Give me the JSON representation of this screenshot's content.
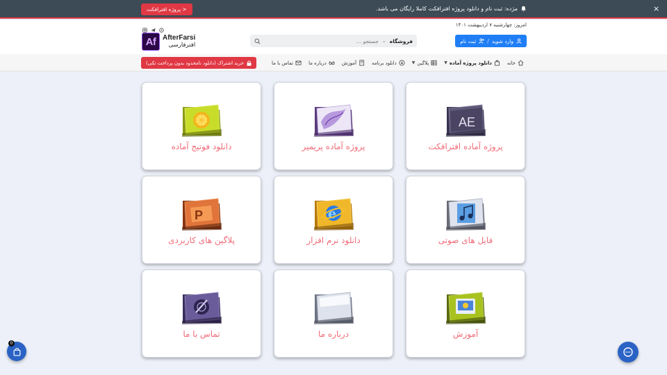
{
  "topbar": {
    "announcement": "مژده: ثبت نام و دانلود پروژه افترافکت کاملا رایگان می باشد.",
    "cta_label": "پروژه افترافکت >",
    "bell_icon": "bell-icon",
    "close_icon": "close-icon"
  },
  "header": {
    "date": "امروز: چهارشنبه ۷ اردیبهشت ۱۴۰۱",
    "login_label": "وارد شوید",
    "register_label": "ثبت نام",
    "separator": "/",
    "search_scope": "فروشگاه",
    "search_placeholder": "جستجو ...",
    "logo_mark": "Af",
    "logo_en": "AfterFarsi",
    "logo_fa": "افترفارسی",
    "socials": [
      "instagram-icon",
      "telegram-icon",
      "aparat-icon"
    ]
  },
  "nav": {
    "items": [
      {
        "label": "خانه",
        "icon": "home-icon"
      },
      {
        "label": "دانلود پروژه آماده",
        "icon": "bag-icon",
        "dropdown": true
      },
      {
        "label": "پلاگین",
        "icon": "grid-icon",
        "dropdown": true
      },
      {
        "label": "دانلود برنامه",
        "icon": "download-icon"
      },
      {
        "label": "آموزش",
        "icon": "book-icon"
      },
      {
        "label": "درباره ما",
        "icon": "glasses-icon"
      },
      {
        "label": "تماس با ما",
        "icon": "mail-icon"
      }
    ],
    "subscription_label": "خرید اشتراک (دانلود نامحدود بدون پرداخت تکی)"
  },
  "cards": [
    {
      "label": "پروژه آماده افترافکت",
      "icon": "after-effects-folder-icon"
    },
    {
      "label": "پروژه آماده پریمیر",
      "icon": "premiere-folder-icon"
    },
    {
      "label": "دانلود فوتیج آماده",
      "icon": "footage-folder-icon"
    },
    {
      "label": "فایل های صوتی",
      "icon": "audio-folder-icon"
    },
    {
      "label": "دانلود نرم افزار",
      "icon": "software-folder-icon"
    },
    {
      "label": "پلاگین های کاربردی",
      "icon": "plugin-folder-icon"
    },
    {
      "label": "آموزش",
      "icon": "tutorial-folder-icon"
    },
    {
      "label": "درباره ما",
      "icon": "about-folder-icon"
    },
    {
      "label": "تماس با ما",
      "icon": "contact-folder-icon"
    }
  ],
  "floating": {
    "cart_count": "0",
    "cart_icon": "shopping-bag-icon",
    "chat_icon": "chat-icon"
  },
  "colors": {
    "topbar_bg": "#3c4b55",
    "accent_red": "#e03844",
    "primary_blue": "#1f7ef5",
    "card_label": "#f06b78",
    "page_bg": "#edf0f8"
  }
}
